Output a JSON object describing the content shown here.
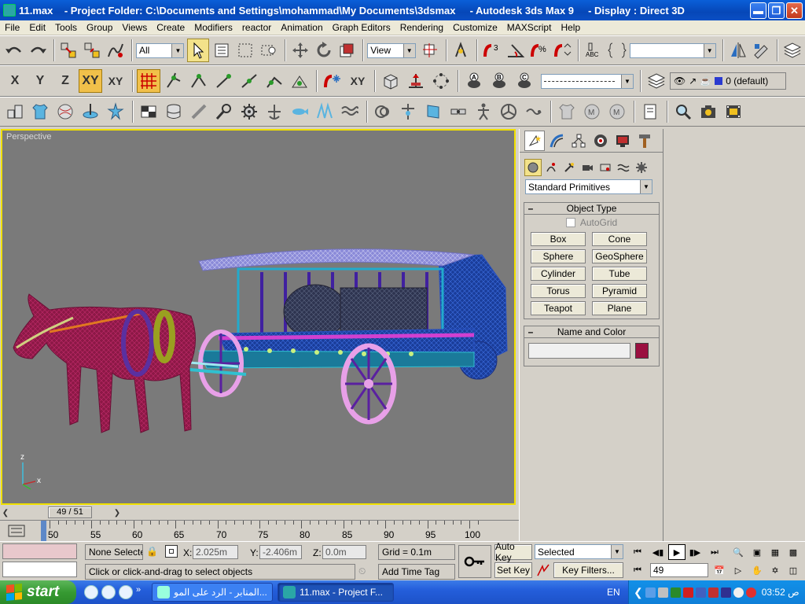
{
  "window": {
    "title": "11.max    - Project Folder: C:\\Documents and Settings\\mohammad\\My Documents\\3dsmax     - Autodesk 3ds Max 9     - Display : Direct 3D",
    "min_icon": "minimize-icon",
    "max_icon": "restore-icon",
    "close_icon": "close-icon"
  },
  "menu": [
    "File",
    "Edit",
    "Tools",
    "Group",
    "Views",
    "Create",
    "Modifiers",
    "reactor",
    "Animation",
    "Graph Editors",
    "Rendering",
    "Customize",
    "MAXScript",
    "Help"
  ],
  "toolbar": {
    "selection_filter": "All",
    "reference_coord": "View",
    "axis_x": "X",
    "axis_y": "Y",
    "axis_z": "Z",
    "axis_xy": "XY",
    "axis_xy2": "XY",
    "layer_value": "0 (default)"
  },
  "viewport": {
    "label": "Perspective",
    "axis_z": "z",
    "axis_x": "x"
  },
  "command_panel": {
    "category": "Standard Primitives",
    "object_type": {
      "title": "Object Type",
      "autogrid": "AutoGrid",
      "buttons": [
        "Box",
        "Cone",
        "Sphere",
        "GeoSphere",
        "Cylinder",
        "Tube",
        "Torus",
        "Pyramid",
        "Teapot",
        "Plane"
      ]
    },
    "name_color": {
      "title": "Name and Color",
      "name_value": "",
      "swatch_color": "#9b1040"
    }
  },
  "timeline": {
    "frame_display": "49 / 51",
    "ticks": [
      "50",
      "55",
      "60",
      "65",
      "70",
      "75",
      "80",
      "85",
      "90",
      "95",
      "100"
    ]
  },
  "status": {
    "selection": "None Selecte",
    "x_label": "X:",
    "x_value": "2.025m",
    "y_label": "Y:",
    "y_value": "-2.406m",
    "z_label": "Z:",
    "z_value": "0.0m",
    "grid": "Grid = 0.1m",
    "prompt": "Click or click-and-drag to select objects",
    "add_time_tag": "Add Time Tag",
    "auto_key": "Auto Key",
    "set_key": "Set Key",
    "key_mode": "Selected",
    "key_filters": "Key Filters...",
    "current_frame": "49"
  },
  "taskbar": {
    "start": "start",
    "tasks": [
      "المنابر - الرد على المو...",
      "11.max       - Project F..."
    ],
    "language": "EN",
    "clock": "ص 03:52"
  }
}
